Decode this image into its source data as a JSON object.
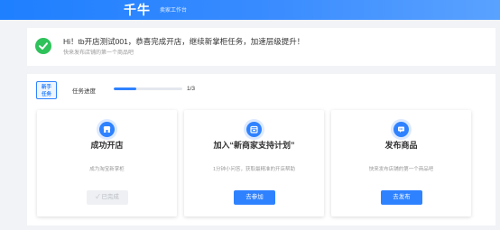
{
  "header": {
    "brand": "千牛",
    "subtitle": "卖家工作台"
  },
  "congrats": {
    "title": "Hi！tb开店测试001，恭喜完成开店，继续新掌柜任务，加速层级提升！",
    "subtitle": "快来发布店铺的第一个商品吧"
  },
  "tasks": {
    "badge_line1": "新手",
    "badge_line2": "任务",
    "progress_label": "任务进度",
    "progress_text": "1/3",
    "progress_fraction": 0.33,
    "cards": [
      {
        "title": "成功开店",
        "desc": "成为淘宝新掌柜",
        "button": "✓ 已完成",
        "done": true,
        "icon": "store-icon"
      },
      {
        "title": "加入“新商家支持计划”",
        "desc": "1分钟小问答，获取最精准的开店帮助",
        "button": "去参加",
        "done": false,
        "icon": "calendar-icon"
      },
      {
        "title": "发布商品",
        "desc": "快来发布店铺的第一个商品吧",
        "button": "去发布",
        "done": false,
        "icon": "message-icon"
      }
    ]
  },
  "colors": {
    "primary": "#2f82ff",
    "success": "#2fc25b",
    "header": "#1e7fff"
  }
}
